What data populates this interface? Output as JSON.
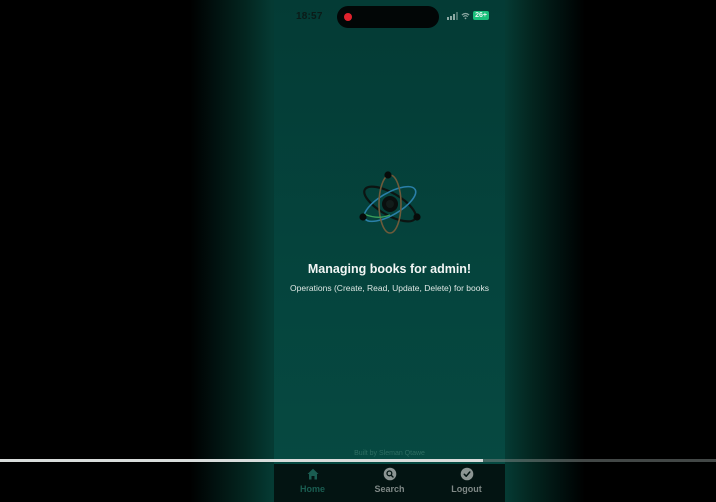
{
  "status_bar": {
    "time": "18:57",
    "battery": "26+"
  },
  "main": {
    "logo_icon": "react-atom-icon",
    "title": "Managing books for admin!",
    "subtitle": "Operations (Create, Read, Update, Delete) for books"
  },
  "footer": {
    "credit": "Built by Sleman Qtawe"
  },
  "tab_bar": {
    "tabs": [
      {
        "label": "Home",
        "icon": "home-icon",
        "active": true
      },
      {
        "label": "Search",
        "icon": "search-icon",
        "active": false
      },
      {
        "label": "Logout",
        "icon": "logout-icon",
        "active": false
      }
    ]
  },
  "video_progress": {
    "fraction": 0.675
  },
  "colors": {
    "background": "#053a33",
    "active_tab": "#1a5d51",
    "inactive_tab": "#7f8886",
    "record_dot": "#e0222d"
  }
}
